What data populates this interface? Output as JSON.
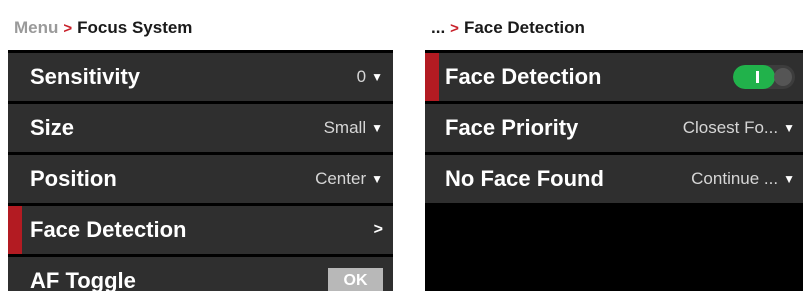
{
  "left_panel": {
    "breadcrumb": {
      "root": "Menu",
      "separator": ">",
      "current": "Focus System"
    },
    "rows": [
      {
        "label": "Sensitivity",
        "value": "0"
      },
      {
        "label": "Size",
        "value": "Small"
      },
      {
        "label": "Position",
        "value": "Center"
      },
      {
        "label": "Face Detection",
        "submenu": ">"
      },
      {
        "label": "AF Toggle",
        "button": "OK"
      }
    ]
  },
  "right_panel": {
    "breadcrumb": {
      "root": "...",
      "separator": ">",
      "current": "Face Detection"
    },
    "rows": [
      {
        "label": "Face Detection",
        "toggle_on": true
      },
      {
        "label": "Face Priority",
        "value": "Closest Fo..."
      },
      {
        "label": "No Face Found",
        "value": "Continue ..."
      }
    ]
  },
  "icons": {
    "dropdown": "caret-down-icon",
    "submenu": "chevron-right-icon"
  },
  "colors": {
    "accent": "#b31b22",
    "toggle_on": "#21b24b",
    "row_bg": "#2f2f2f",
    "background": "#000000"
  }
}
